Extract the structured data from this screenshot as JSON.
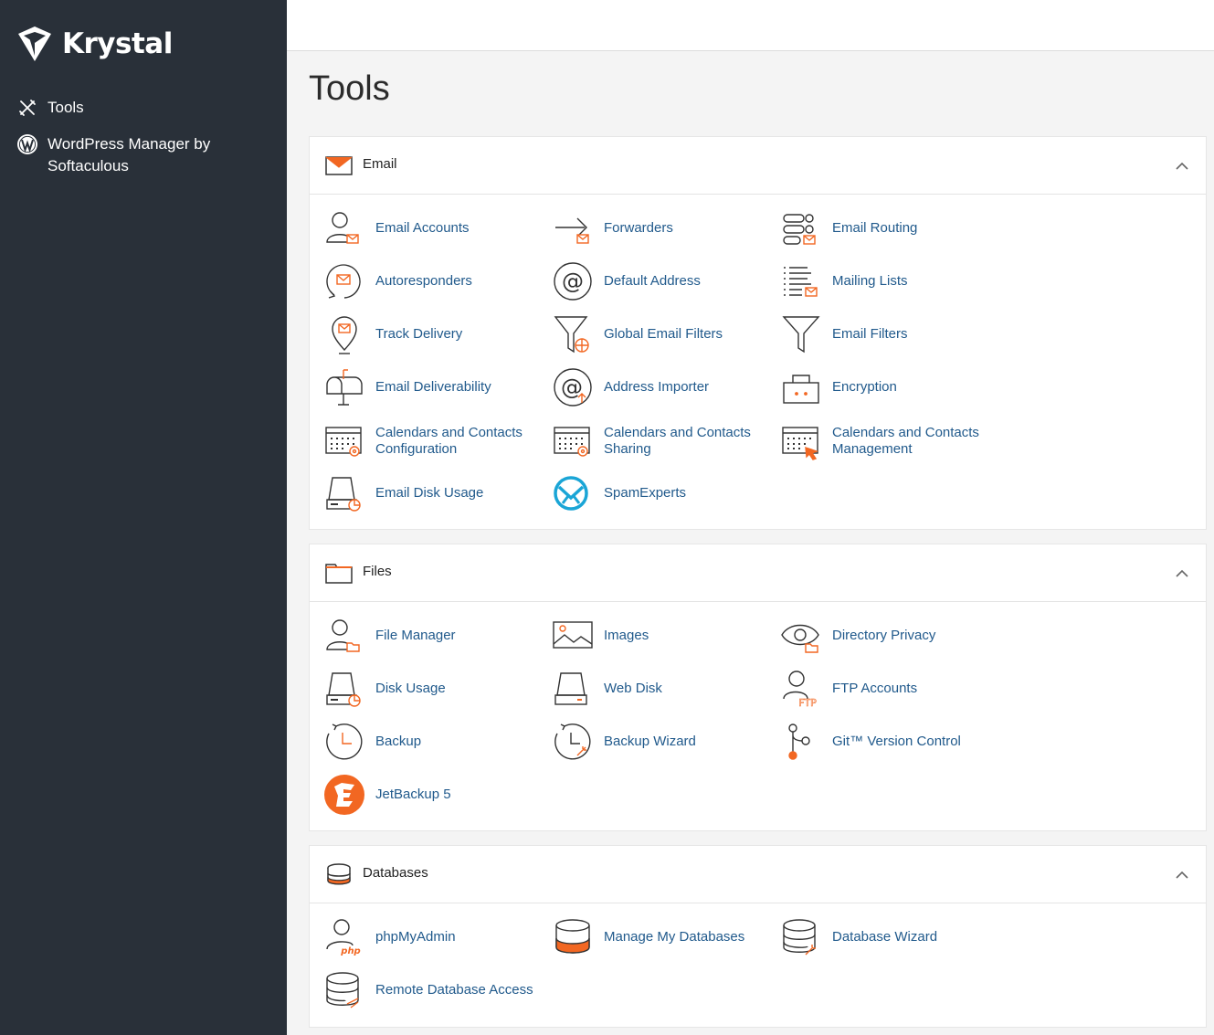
{
  "sidebar": {
    "brand": "Krystal",
    "items": [
      {
        "label": "Tools",
        "icon": "tools-icon"
      },
      {
        "label": "WordPress Manager by Softaculous",
        "icon": "wordpress-icon"
      }
    ]
  },
  "page": {
    "title": "Tools"
  },
  "colors": {
    "accent": "#f26722",
    "link": "#215a8c",
    "sidebar": "#293039"
  },
  "sections": {
    "email": {
      "title": "Email",
      "items": [
        {
          "label": "Email Accounts",
          "icon": "email-accounts-icon"
        },
        {
          "label": "Forwarders",
          "icon": "forwarders-icon"
        },
        {
          "label": "Email Routing",
          "icon": "email-routing-icon"
        },
        {
          "label": "Autoresponders",
          "icon": "autoresponders-icon"
        },
        {
          "label": "Default Address",
          "icon": "default-address-icon"
        },
        {
          "label": "Mailing Lists",
          "icon": "mailing-lists-icon"
        },
        {
          "label": "Track Delivery",
          "icon": "track-delivery-icon"
        },
        {
          "label": "Global Email Filters",
          "icon": "global-email-filters-icon"
        },
        {
          "label": "Email Filters",
          "icon": "email-filters-icon"
        },
        {
          "label": "Email Deliverability",
          "icon": "email-deliverability-icon"
        },
        {
          "label": "Address Importer",
          "icon": "address-importer-icon"
        },
        {
          "label": "Encryption",
          "icon": "encryption-icon"
        },
        {
          "label": "Calendars and Contacts Configuration",
          "icon": "calendar-config-icon"
        },
        {
          "label": "Calendars and Contacts Sharing",
          "icon": "calendar-sharing-icon"
        },
        {
          "label": "Calendars and Contacts Management",
          "icon": "calendar-management-icon"
        },
        {
          "label": "Email Disk Usage",
          "icon": "email-disk-usage-icon"
        },
        {
          "label": "SpamExperts",
          "icon": "spamexperts-icon"
        }
      ]
    },
    "files": {
      "title": "Files",
      "items": [
        {
          "label": "File Manager",
          "icon": "file-manager-icon"
        },
        {
          "label": "Images",
          "icon": "images-icon"
        },
        {
          "label": "Directory Privacy",
          "icon": "directory-privacy-icon"
        },
        {
          "label": "Disk Usage",
          "icon": "disk-usage-icon"
        },
        {
          "label": "Web Disk",
          "icon": "web-disk-icon"
        },
        {
          "label": "FTP Accounts",
          "icon": "ftp-accounts-icon",
          "icon_text": "FTP"
        },
        {
          "label": "Backup",
          "icon": "backup-icon"
        },
        {
          "label": "Backup Wizard",
          "icon": "backup-wizard-icon"
        },
        {
          "label": "Git™ Version Control",
          "icon": "git-icon"
        },
        {
          "label": "JetBackup 5",
          "icon": "jetbackup-icon"
        }
      ]
    },
    "databases": {
      "title": "Databases",
      "items": [
        {
          "label": "phpMyAdmin",
          "icon": "phpmyadmin-icon",
          "icon_text": "php"
        },
        {
          "label": "Manage My Databases",
          "icon": "manage-databases-icon"
        },
        {
          "label": "Database Wizard",
          "icon": "database-wizard-icon"
        },
        {
          "label": "Remote Database Access",
          "icon": "remote-database-icon"
        }
      ]
    }
  }
}
